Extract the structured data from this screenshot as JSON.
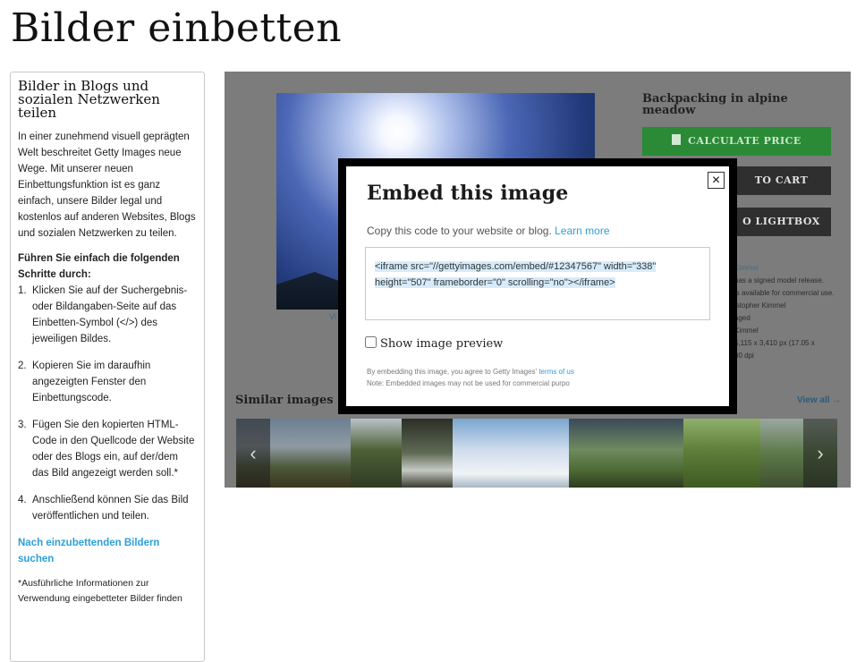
{
  "page": {
    "title": "Bilder einbetten"
  },
  "sidebar": {
    "heading": "Bilder in Blogs und sozialen Netzwerken teilen",
    "intro": "In einer zunehmend visuell geprägten Welt beschreitet Getty Images neue Wege. Mit unserer neuen Einbettungsfunktion ist es ganz einfach, unsere Bilder legal und kostenlos auf anderen Websites, Blogs und sozialen Netzwerken zu teilen.",
    "steps_title": "Führen Sie einfach die folgenden Schritte durch:",
    "steps": [
      {
        "num": "1.",
        "text": "Klicken Sie auf der Suchergebnis- oder Bildangaben-Seite auf das Einbetten-Symbol (</>) des jeweiligen Bildes."
      },
      {
        "num": "2.",
        "text": "Kopieren Sie im daraufhin angezeigten Fenster den Einbettungscode."
      },
      {
        "num": "3.",
        "text": "Fügen Sie den kopierten HTML-Code in den Quellcode der Website oder des Blogs ein, auf der/dem das Bild angezeigt werden soll.*"
      },
      {
        "num": "4.",
        "text": "Anschließend können Sie das Bild veröffentlichen und teilen."
      }
    ],
    "search_link": "Nach einzubettenden Bildern suchen",
    "footnote": "*Ausführliche Informationen zur Verwendung eingebetteter Bilder finden"
  },
  "preview": {
    "view_link": "Vi",
    "image_title": "Backpacking in alpine meadow",
    "buttons": {
      "price": "Calculate price",
      "cart": "to cart",
      "lightbox": "o lightbox"
    },
    "details": [
      "Kimmel",
      "has a signed model release.",
      "is available for commercial use.",
      "istopher Kimmel",
      "aged",
      "Kimmel",
      "5,115 x 3,410 px (17.05 x",
      "00 dpi"
    ],
    "similar_title": "Similar images",
    "view_all": "View all →",
    "arrow_left": "‹",
    "arrow_right": "›"
  },
  "modal": {
    "title": "Embed this image",
    "intro": "Copy this code to your website or blog.",
    "learn_more": "Learn more",
    "code_line1": "<iframe src=\"//gettyimages.com/embed/#12347567\" width=\"338\"",
    "code_line2": "height=\"507\" frameborder=\"0\" scrolling=\"no\"></iframe>",
    "preview_label": "Show image preview",
    "legal_line1": "By embedding this image, you agree to Getty Images'",
    "terms": "terms of us",
    "legal_line2": "Note: Embedded images may not be used for commercial purpo",
    "close": "×"
  },
  "colors": {
    "link": "#2d9fd9",
    "price_button": "#2a8a35",
    "dark_button": "#2f2f2f",
    "overlay": "#7c7c7c"
  }
}
